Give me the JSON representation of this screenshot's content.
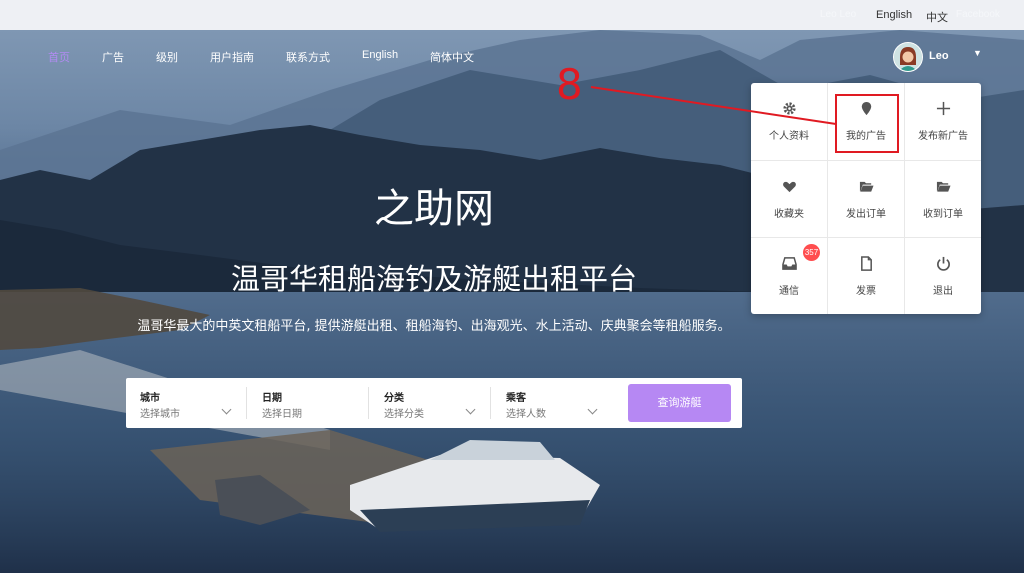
{
  "topbar": {
    "lang_english": "English",
    "lang_chinese": "中文"
  },
  "nav": {
    "items": [
      "首页",
      "广告",
      "级别",
      "用户指南",
      "联系方式",
      "English",
      "简体中文"
    ],
    "active_index": 0
  },
  "user": {
    "name": "Leo",
    "caret": "▼"
  },
  "hero": {
    "title": "之助网",
    "subtitle": "温哥华租船海钓及游艇出租平台",
    "description": "温哥华最大的中英文租船平台, 提供游艇出租、租船海钓、出海观光、水上活动、庆典聚会等租船服务。"
  },
  "search": {
    "fields": [
      {
        "label": "城市",
        "placeholder": "选择城市"
      },
      {
        "label": "日期",
        "placeholder": "选择日期"
      },
      {
        "label": "分类",
        "placeholder": "选择分类"
      },
      {
        "label": "乘客",
        "placeholder": "选择人数"
      }
    ],
    "button_label": "查询游艇"
  },
  "user_menu": {
    "items": [
      {
        "label": "个人资料",
        "icon": "gear-icon"
      },
      {
        "label": "我的广告",
        "icon": "map-pin-icon"
      },
      {
        "label": "发布新广告",
        "icon": "plus-icon"
      },
      {
        "label": "收藏夹",
        "icon": "heart-icon"
      },
      {
        "label": "发出订单",
        "icon": "folder-open-icon"
      },
      {
        "label": "收到订单",
        "icon": "folder-open-icon"
      },
      {
        "label": "通信",
        "icon": "inbox-icon"
      },
      {
        "label": "发票",
        "icon": "file-icon"
      },
      {
        "label": "退出",
        "icon": "power-icon"
      }
    ],
    "message_badge": "357"
  },
  "annotation": {
    "step_number": "8",
    "color": "#e01a22"
  },
  "colors": {
    "accent": "#b688f3",
    "active_nav": "#b18bf2",
    "badge": "#ff4d4f"
  }
}
